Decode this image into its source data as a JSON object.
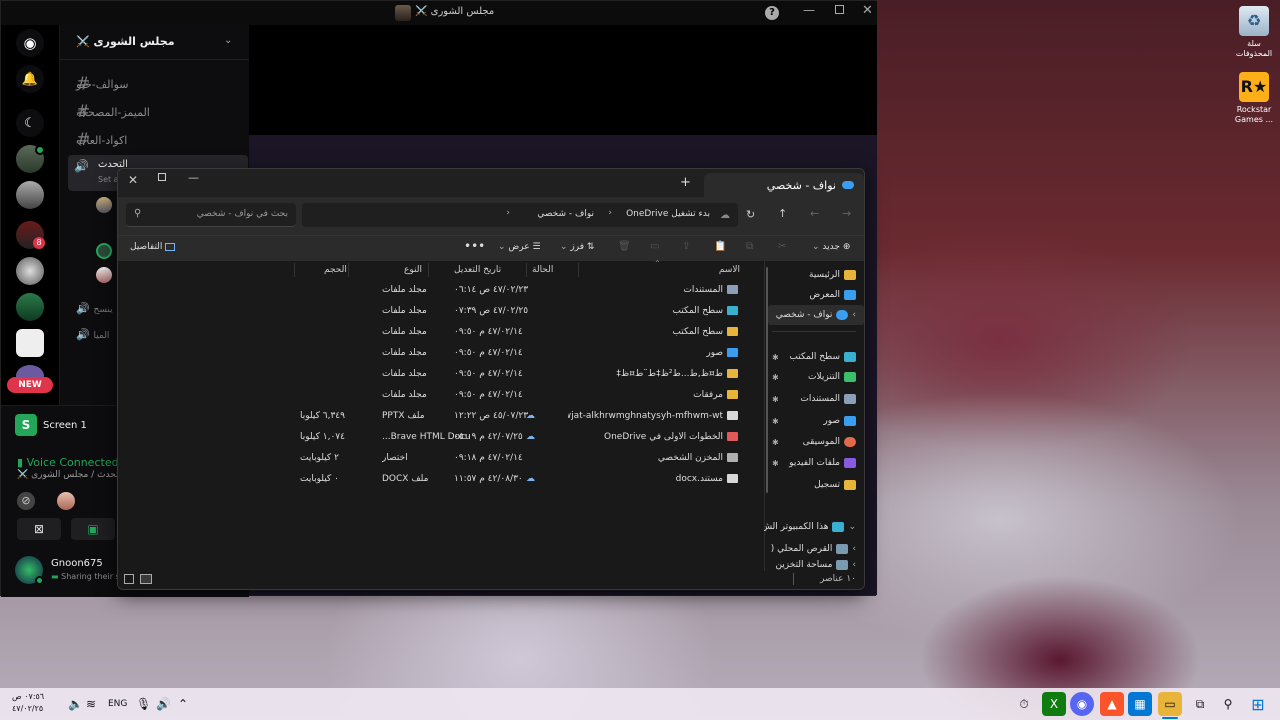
{
  "desktop": {
    "icons": [
      {
        "name": "recycle-bin",
        "label": "سلة المحذوفات"
      },
      {
        "name": "rockstar",
        "label": "Rockstar Games ..."
      }
    ]
  },
  "discord": {
    "title": "مجلس الشورى ⚔️",
    "server_name": "مجلس الشورى ⚔️",
    "new_badge": "NEW",
    "server_badges": [
      "8"
    ],
    "channels": [
      {
        "label": "سوالف-خيو"
      },
      {
        "label": "الميمز-المصحكة"
      },
      {
        "label": "اكواد-العاب"
      }
    ],
    "voice_channel": {
      "label": "التحدث",
      "sub": "Set a"
    },
    "voice_channels_more": [
      {
        "label": "ينسح"
      },
      {
        "label": "الميا"
      }
    ],
    "stream": {
      "label": "Screen 1"
    },
    "voice_status": {
      "title": "Voice Connected",
      "sub": "التحدث / مجلس الشورى ⚔️"
    },
    "user": {
      "name": "Gnoon675",
      "status": "Sharing their s"
    }
  },
  "explorer": {
    "tab_title": "نواف - شخصي",
    "breadcrumb": {
      "onedrive": "بدء تشغيل OneDrive",
      "folder": "نواف - شخصي"
    },
    "search_placeholder": "بحث في نواف - شخصي",
    "cmd": {
      "new": "جديد",
      "sort": "فرز",
      "view": "عرض",
      "details": "التفاصيل"
    },
    "nav": {
      "home": "الرئيسية",
      "gallery": "المعرض",
      "onedrive": "نواف - شخصي",
      "pinned": [
        "سطح المكتب",
        "التنزيلات",
        "المستندات",
        "صور",
        "الموسيقى",
        "ملفات الفيديو",
        "تسجيل"
      ],
      "this_pc": "هذا الكمبيوتر الش",
      "local_disk": "القرص المحلي (",
      "more": "مساحة التخزين"
    },
    "columns": {
      "name": "الاسم",
      "status": "الحالة",
      "date": "تاريخ التعديل",
      "type": "النوع",
      "size": "الحجم"
    },
    "files": [
      {
        "name": "المستندات",
        "date": "٤٧/٠٢/٢٣ ص ٠٦:١٤",
        "type": "مجلد ملفات",
        "size": "",
        "icon": "doc-folder",
        "cloud": false
      },
      {
        "name": "سطح المكتب",
        "date": "٤٧/٠٢/٢٥ ص ٠٧:٣٩",
        "type": "مجلد ملفات",
        "size": "",
        "icon": "desktop-folder",
        "cloud": false
      },
      {
        "name": "سطح المكتب",
        "date": "٤٧/٠٢/١٤ م ٠٩:٥٠",
        "type": "مجلد ملفات",
        "size": "",
        "icon": "folder",
        "cloud": false
      },
      {
        "name": "صور",
        "date": "٤٧/٠٢/١٤ م ٠٩:٥٠",
        "type": "مجلد ملفات",
        "size": "",
        "icon": "image-folder",
        "cloud": false
      },
      {
        "name": "ط¤ظ‚ط...ط²ظ‡ط¨ط¤ظ‡",
        "date": "٤٧/٠٢/١٤ م ٠٩:٥٠",
        "type": "مجلد ملفات",
        "size": "",
        "icon": "folder",
        "cloud": false
      },
      {
        "name": "مرفقات",
        "date": "٤٧/٠٢/١٤ م ٠٩:٥٠",
        "type": "مجلد ملفات",
        "size": "",
        "icon": "folder",
        "cloud": false
      },
      {
        "name": "almwjat-alkhrwmghnatysyh-mfhwm-wt...",
        "date": "٤٥/٠٧/٢٣ ص ١٢:٢٢",
        "type": "ملف PPTX",
        "size": "٦,٣٤٩ كيلوبا",
        "icon": "file",
        "cloud": true
      },
      {
        "name": "الخطوات الأولى في OneDrive",
        "date": "٤٢/٠٧/٢٥ م ٠٥:٠٩",
        "type": "Brave HTML Docu...",
        "size": "١,٠٧٤ كيلوبا",
        "icon": "html-file",
        "cloud": true
      },
      {
        "name": "المخزن الشخصي",
        "date": "٤٧/٠٢/١٤ م ٠٩:١٨",
        "type": "اختصار",
        "size": "٢ كيلوبايت",
        "icon": "shortcut",
        "cloud": false
      },
      {
        "name": "مستند.docx",
        "date": "٤٢/٠٨/٣٠ م ١١:٥٧",
        "type": "ملف DOCX",
        "size": "٠ كيلوبايت",
        "icon": "file",
        "cloud": true
      }
    ],
    "status_count": "١٠ عناصر"
  },
  "taskbar": {
    "time": "٠٧:٥٦ ص",
    "date": "٤٧/٠٢/٢٥",
    "lang": "ENG"
  },
  "colors": {
    "discord_green": "#23a55a",
    "folder_yellow": "#e8b53a",
    "onedrive_blue": "#3a9ef0",
    "new_red": "#e0344a"
  }
}
